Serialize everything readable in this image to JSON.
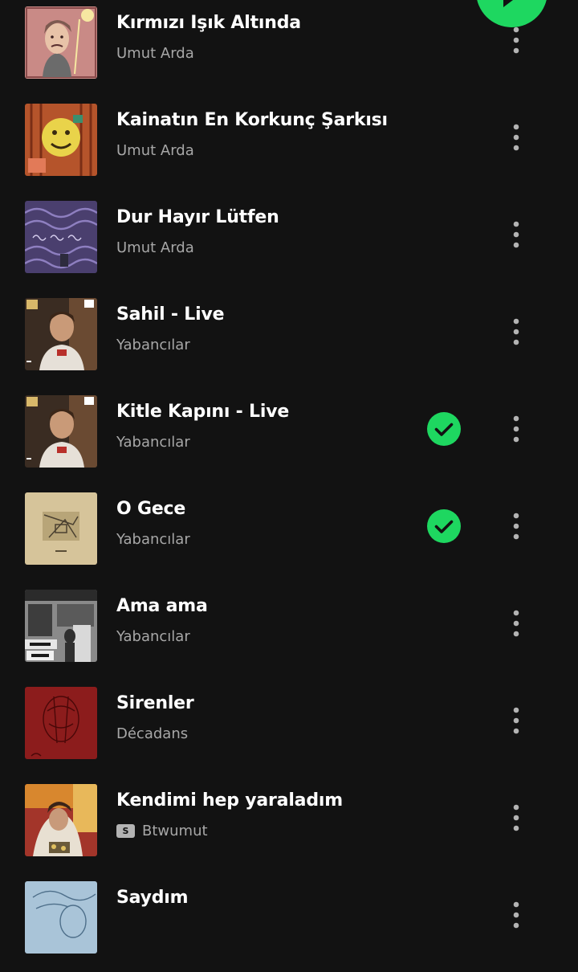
{
  "tracks": [
    {
      "title": "Kırmızı Işık Altında",
      "artist": "Umut Arda",
      "downloaded": false,
      "cover": "cover-pink-portrait"
    },
    {
      "title": "Kainatın En Korkunç Şarkısı",
      "artist": "Umut Arda",
      "downloaded": false,
      "cover": "cover-orange-smiley"
    },
    {
      "title": "Dur Hayır Lütfen",
      "artist": "Umut Arda",
      "downloaded": false,
      "cover": "cover-purple-swirl"
    },
    {
      "title": "Sahil - Live",
      "artist": "Yabancılar",
      "downloaded": false,
      "cover": "cover-live-performance"
    },
    {
      "title": "Kitle Kapını - Live",
      "artist": "Yabancılar",
      "downloaded": true,
      "cover": "cover-live-performance"
    },
    {
      "title": "O Gece",
      "artist": "Yabancılar",
      "downloaded": true,
      "cover": "cover-beige-sketch"
    },
    {
      "title": "Ama ama",
      "artist": "Yabancılar",
      "downloaded": false,
      "cover": "cover-bw-street"
    },
    {
      "title": "Sirenler",
      "artist": "Décadans",
      "downloaded": false,
      "cover": "cover-red-drawing"
    },
    {
      "title": "Kendimi hep yaraladım",
      "artist": "Btwumut",
      "downloaded": false,
      "badge": "S",
      "cover": "cover-painting"
    },
    {
      "title": "Saydım",
      "artist": "",
      "downloaded": false,
      "cover": "cover-blue-sketch"
    }
  ],
  "colors": {
    "background": "#121212",
    "accent_green": "#1ed760",
    "subtext": "#a7a7a7"
  },
  "icons": {
    "play": "play-icon",
    "downloaded": "check-circle-icon",
    "more": "more-vertical-icon"
  }
}
